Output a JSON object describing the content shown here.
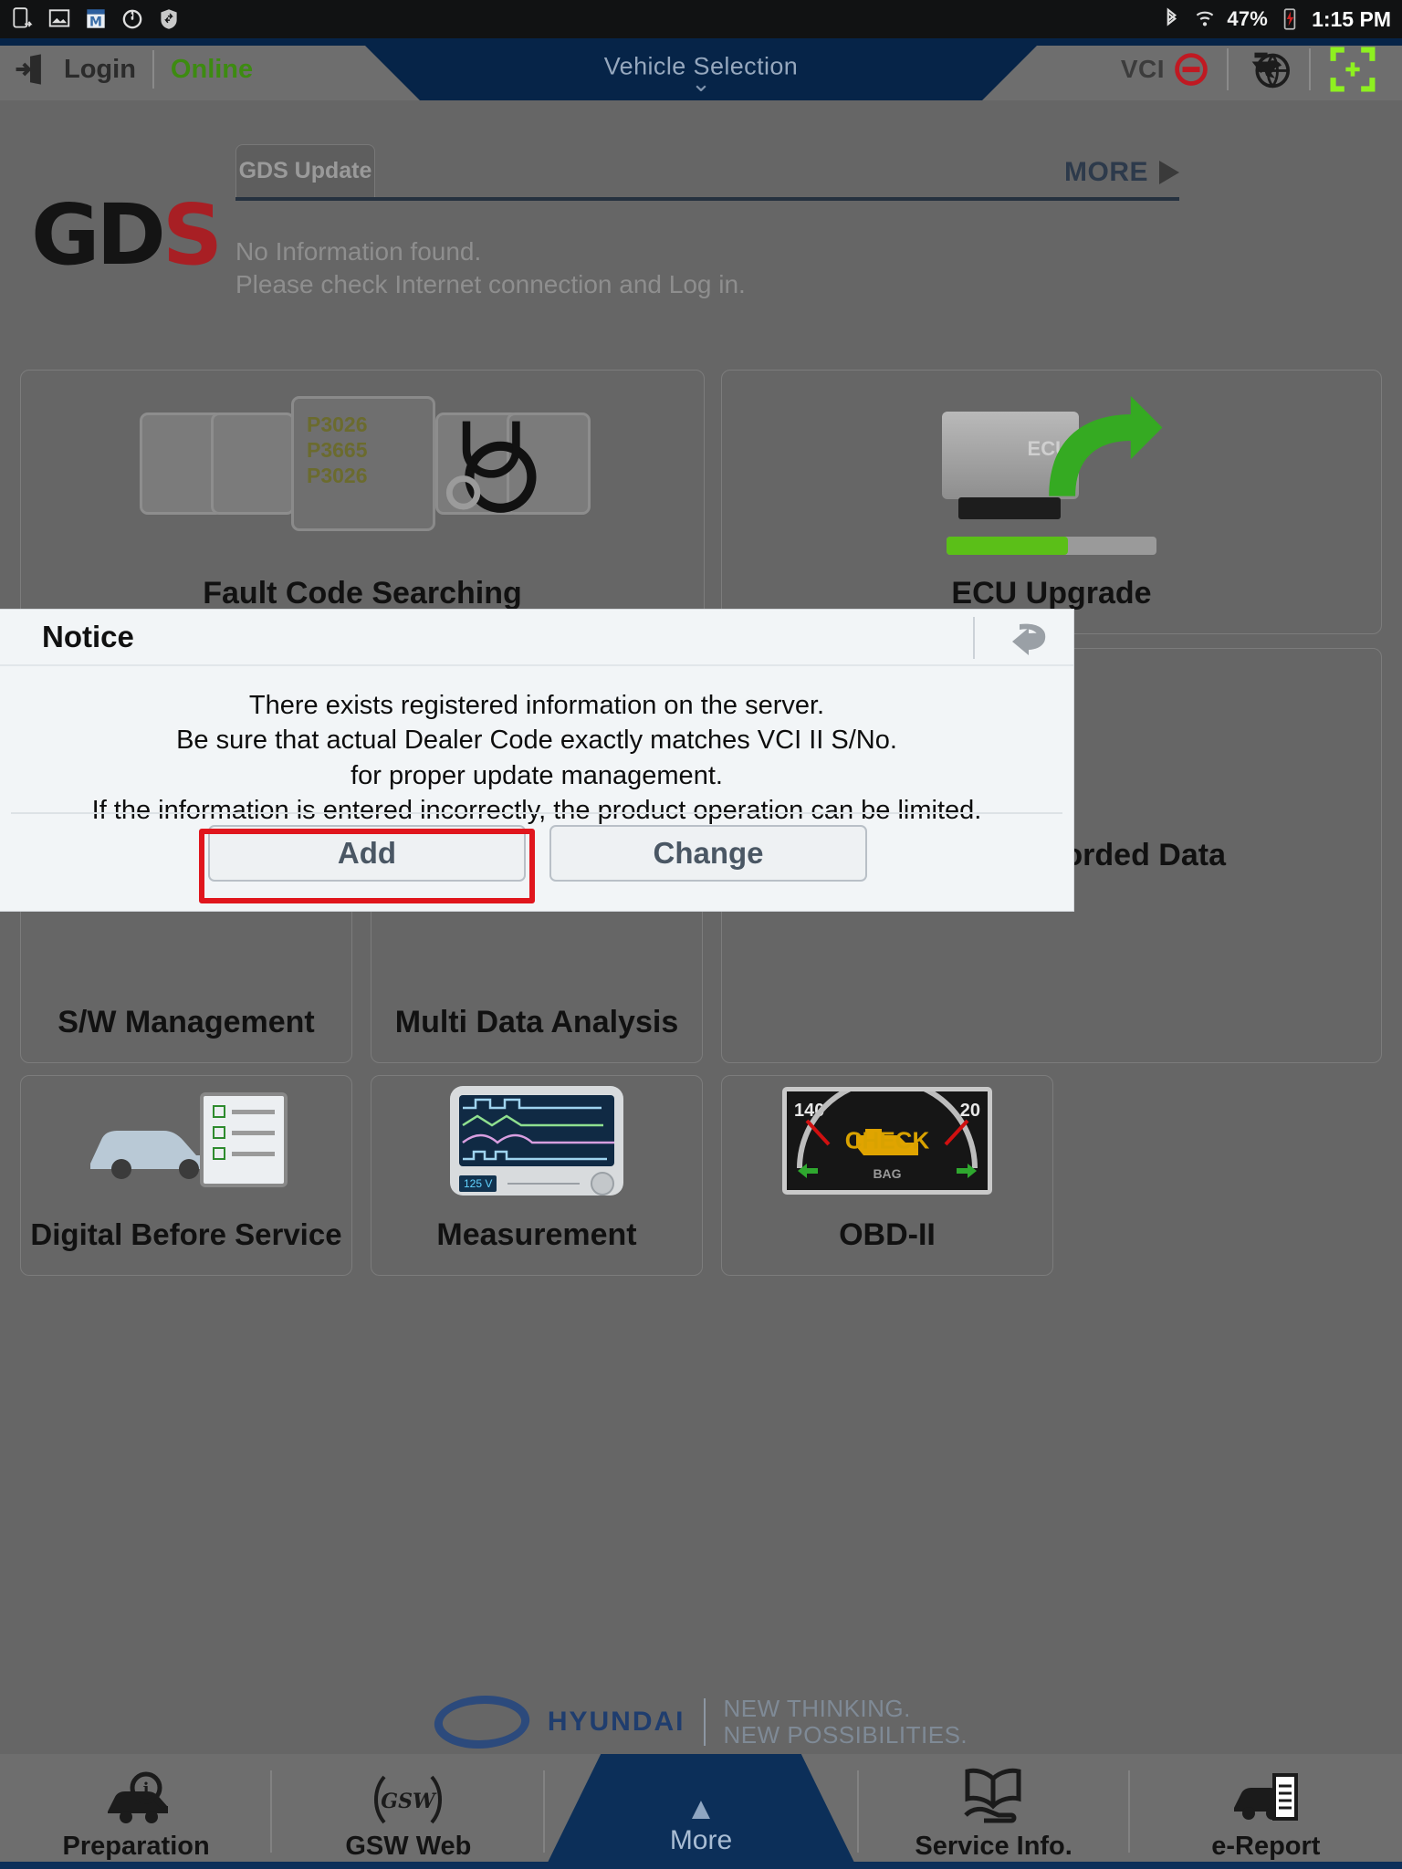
{
  "statusbar": {
    "icons": [
      "screenshot-icon",
      "gallery-icon",
      "mail-m-icon",
      "power-circle-icon",
      "shield-icon"
    ],
    "bluetooth_icon": "bluetooth-icon",
    "wifi_icon": "wifi-icon",
    "battery_percent": "47%",
    "battery_icon": "battery-charging-icon",
    "time": "1:15 PM"
  },
  "titlebar": {
    "login_label": "Login",
    "status_label": "Online",
    "center_title": "Vehicle Selection",
    "chevron": "⌄",
    "vci_label": "VCI",
    "vci_state_icon": "no-entry-icon",
    "update_icon": "globe-download-icon",
    "capture_icon": "screen-capture-icon",
    "accent_blue": "#062448",
    "online_green": "#3d8b11",
    "vci_red": "#c01922"
  },
  "tabs": {
    "items": [
      {
        "label": "GDS Update",
        "active": false
      }
    ],
    "more_label": "MORE",
    "more_icon": "triangle-right-icon"
  },
  "brand": {
    "logo_text": "GD",
    "logo_accent": "S",
    "logo_accent_color": "#a81f24"
  },
  "info": {
    "line1": "No Information found.",
    "line2": "Please check Internet connection and Log in."
  },
  "tiles": [
    {
      "label": "Fault Code Searching",
      "icon": "dtc-cards-stethoscope-icon",
      "dtc_codes": [
        "P3026",
        "P3665",
        "P3026"
      ]
    },
    {
      "label": "ECU Upgrade",
      "icon": "ecu-upload-arrow-icon"
    },
    {
      "label": "S/W Management",
      "icon": "ecu-gears-icon"
    },
    {
      "label": "Multi Data Analysis",
      "icon": "waveform-screens-icon"
    },
    {
      "label": "Recorded Data",
      "icon": "play-pause-icon"
    },
    {
      "label": "Digital Before Service",
      "icon": "car-checklist-icon"
    },
    {
      "label": "Measurement",
      "icon": "oscilloscope-icon",
      "display_value": "125 V"
    },
    {
      "label": "OBD-II",
      "icon": "cluster-check-icon",
      "gauge_left": "140",
      "gauge_right": "20",
      "warn_text": "CHECK",
      "sub_text": "BAG"
    }
  ],
  "footer_brand": {
    "name": "HYUNDAI",
    "tagline_line1": "NEW THINKING.",
    "tagline_line2": "NEW POSSIBILITIES."
  },
  "bottomnav": {
    "items": [
      {
        "label": "Preparation",
        "icon": "car-inspect-icon"
      },
      {
        "label": "GSW Web",
        "icon": "gsw-icon"
      },
      {
        "label": "More",
        "icon": "chevron-up-icon"
      },
      {
        "label": "Service Info.",
        "icon": "book-hand-icon"
      },
      {
        "label": "e-Report",
        "icon": "car-report-icon"
      }
    ]
  },
  "dialog": {
    "title": "Notice",
    "back_icon": "return-arrow-icon",
    "message_lines": [
      "There exists registered information on the server.",
      "Be sure that actual Dealer Code exactly matches VCI II S/No.",
      "for proper update management.",
      "If the information is entered incorrectly, the product operation can be limited."
    ],
    "buttons": [
      {
        "label": "Add",
        "highlighted": true
      },
      {
        "label": "Change",
        "highlighted": false
      }
    ],
    "highlight_color": "#e0161d"
  }
}
